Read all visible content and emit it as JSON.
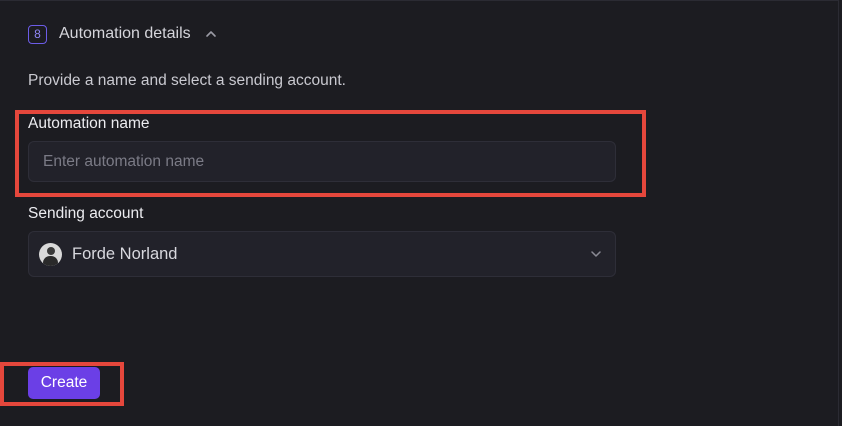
{
  "section": {
    "step_number": "8",
    "title": "Automation details",
    "description": "Provide a name and select a sending account."
  },
  "automation_name": {
    "label": "Automation name",
    "placeholder": "Enter automation name",
    "value": ""
  },
  "sending_account": {
    "label": "Sending account",
    "selected": "Forde Norland"
  },
  "actions": {
    "create_label": "Create"
  },
  "colors": {
    "background": "#1c1c21",
    "accent": "#6b3fe6",
    "highlight": "#e5473c"
  }
}
